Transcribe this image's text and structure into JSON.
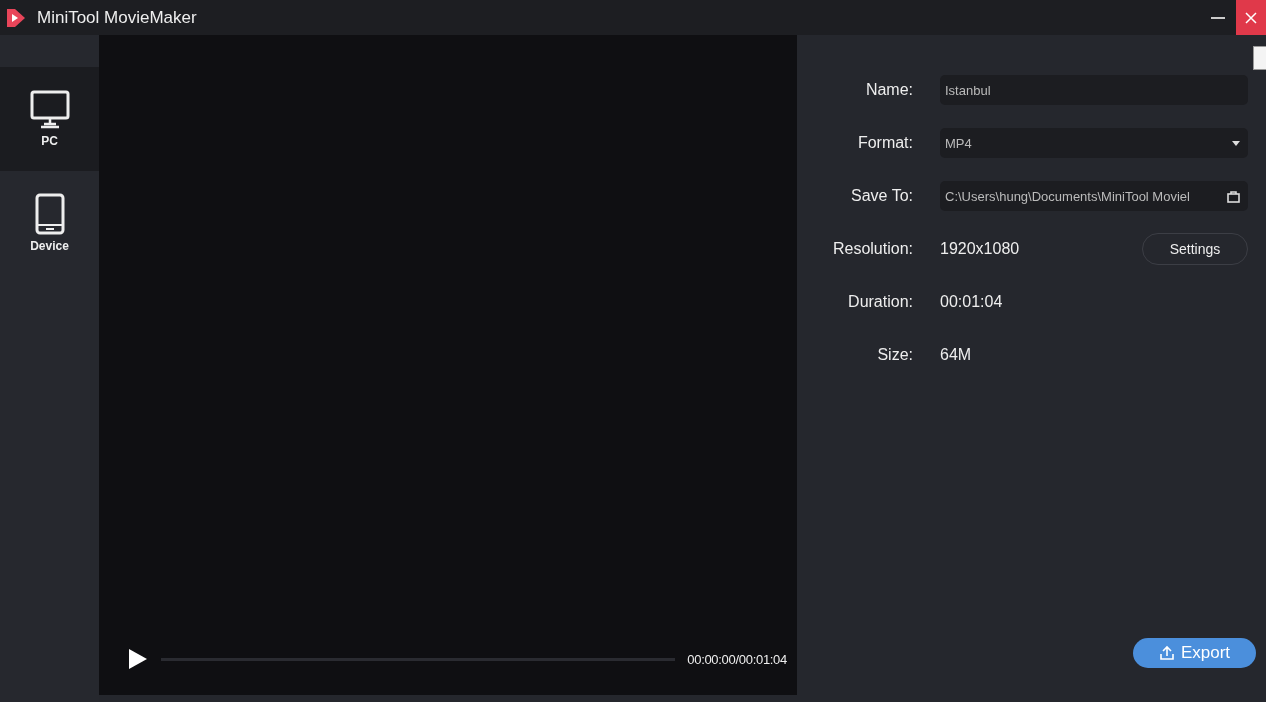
{
  "window": {
    "title": "MiniTool MovieMaker"
  },
  "sidebar": {
    "items": [
      {
        "label": "PC",
        "kind": "pc",
        "selected": true
      },
      {
        "label": "Device",
        "kind": "device",
        "selected": false
      }
    ]
  },
  "player": {
    "level": 0,
    "time": "00:00:00/00:01:04"
  },
  "form": {
    "rows": [
      {
        "kind": "input",
        "label": "Name:",
        "value": "Istanbul"
      },
      {
        "kind": "select",
        "label": "Format:",
        "value": "MP4"
      },
      {
        "kind": "path",
        "label": "Save To:",
        "value": "C:\\Users\\hung\\Documents\\MiniTool Moviel"
      },
      {
        "kind": "info",
        "label": "Resolution:",
        "value": "1920x1080",
        "button": "Settings"
      },
      {
        "kind": "info",
        "label": "Duration:",
        "value": "00:01:04"
      },
      {
        "kind": "info",
        "label": "Size:",
        "value": "64M"
      }
    ]
  },
  "export_button": "Export"
}
